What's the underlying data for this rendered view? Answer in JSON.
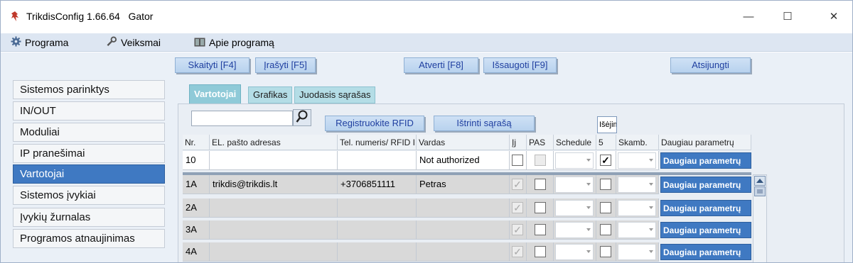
{
  "window": {
    "title": "TrikdisConfig 1.66.64",
    "subtitle": "Gator",
    "controls": {
      "minimize": "—",
      "maximize": "☐",
      "close": "✕"
    }
  },
  "menu": {
    "items": [
      {
        "label": "Programa",
        "icon": "gear-icon"
      },
      {
        "label": "Veiksmai",
        "icon": "wrench-icon"
      },
      {
        "label": "Apie programą",
        "icon": "book-icon"
      }
    ]
  },
  "toolbar": {
    "read": "Skaityti [F4]",
    "write": "Įrašyti [F5]",
    "open": "Atverti [F8]",
    "save": "Išsaugoti [F9]",
    "disconnect": "Atsijungti"
  },
  "sidebar": {
    "items": [
      {
        "label": "Sistemos parinktys",
        "active": false
      },
      {
        "label": "IN/OUT",
        "active": false
      },
      {
        "label": "Moduliai",
        "active": false
      },
      {
        "label": "IP pranešimai",
        "active": false
      },
      {
        "label": "Vartotojai",
        "active": true
      },
      {
        "label": "Sistemos įvykiai",
        "active": false
      },
      {
        "label": "Įvykių žurnalas",
        "active": false
      },
      {
        "label": "Programos atnaujinimas",
        "active": false
      }
    ]
  },
  "tabs": [
    {
      "label": "Vartotojai",
      "active": true
    },
    {
      "label": "Grafikas",
      "active": false
    },
    {
      "label": "Juodasis sąrašas",
      "active": false
    }
  ],
  "users": {
    "search": {
      "value": "",
      "placeholder": ""
    },
    "register_rfid": "Registruokite RFID",
    "clear_list": "Ištrinti sąrašą",
    "exit_label": "Išėjimas",
    "columns": [
      "Nr.",
      "EL. pašto adresas",
      "Tel. numeris/ RFID ID",
      "Vardas",
      "Įj",
      "PAS",
      "Schedule",
      "5",
      "Skamb.",
      "Daugiau parametrų"
    ],
    "top_row": {
      "nr": "10",
      "email": "",
      "phone": "",
      "name": "Not authorized",
      "ij": false,
      "pas": false,
      "out5": true,
      "more": "Daugiau parametrų"
    },
    "rows": [
      {
        "nr": "1A",
        "email": "trikdis@trikdis.lt",
        "phone": "+3706851111",
        "name": "Petras",
        "ij": true,
        "pas": false,
        "out5": false,
        "more": "Daugiau parametrų"
      },
      {
        "nr": "2A",
        "email": "",
        "phone": "",
        "name": "",
        "ij": true,
        "pas": false,
        "out5": false,
        "more": "Daugiau parametrų"
      },
      {
        "nr": "3A",
        "email": "",
        "phone": "",
        "name": "",
        "ij": true,
        "pas": false,
        "out5": false,
        "more": "Daugiau parametrų"
      },
      {
        "nr": "4A",
        "email": "",
        "phone": "",
        "name": "",
        "ij": true,
        "pas": false,
        "out5": false,
        "more": "Daugiau parametrų"
      }
    ]
  },
  "colors": {
    "accent": "#3f79c2",
    "menubar": "#dde6f2",
    "tab_active": "#8fcad8",
    "tab_inactive": "#b4dde6",
    "button_text": "#1f3fa0"
  }
}
